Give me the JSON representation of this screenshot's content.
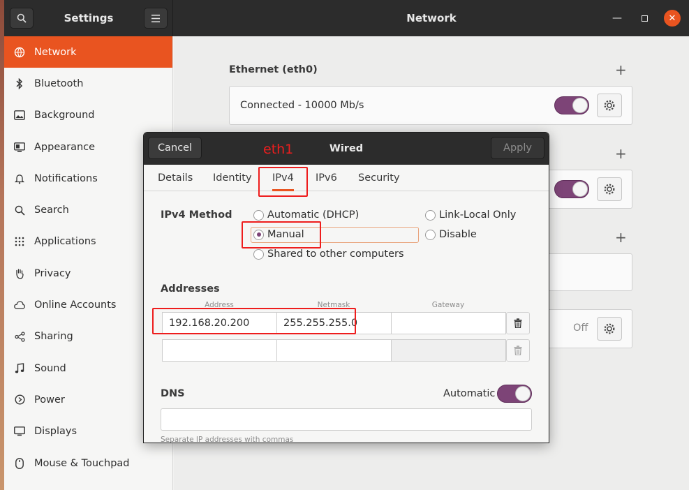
{
  "window": {
    "sidebar_title": "Settings",
    "title": "Network",
    "minimize_icon": "minimize-icon",
    "maximize_icon": "maximize-icon",
    "close_icon": "close-icon"
  },
  "sidebar": {
    "items": [
      {
        "label": "Network",
        "icon": "network-icon",
        "active": true
      },
      {
        "label": "Bluetooth",
        "icon": "bluetooth-icon"
      },
      {
        "label": "Background",
        "icon": "background-icon"
      },
      {
        "label": "Appearance",
        "icon": "appearance-icon"
      },
      {
        "label": "Notifications",
        "icon": "bell-icon"
      },
      {
        "label": "Search",
        "icon": "search-icon"
      },
      {
        "label": "Applications",
        "icon": "grid-icon"
      },
      {
        "label": "Privacy",
        "icon": "hand-icon"
      },
      {
        "label": "Online Accounts",
        "icon": "cloud-icon"
      },
      {
        "label": "Sharing",
        "icon": "share-icon"
      },
      {
        "label": "Sound",
        "icon": "music-note-icon"
      },
      {
        "label": "Power",
        "icon": "power-icon"
      },
      {
        "label": "Displays",
        "icon": "display-icon"
      },
      {
        "label": "Mouse & Touchpad",
        "icon": "mouse-icon"
      }
    ]
  },
  "main": {
    "ethernet_title": "Ethernet (eth0)",
    "ethernet_status": "Connected - 10000 Mb/s",
    "off_label": "Off"
  },
  "dialog": {
    "cancel": "Cancel",
    "title": "Wired",
    "apply": "Apply",
    "tabs": [
      "Details",
      "Identity",
      "IPv4",
      "IPv6",
      "Security"
    ],
    "active_tab": "IPv4",
    "ipv4_method_label": "IPv4 Method",
    "methods": {
      "automatic": "Automatic (DHCP)",
      "link_local": "Link-Local Only",
      "manual": "Manual",
      "disable": "Disable",
      "shared": "Shared to other computers"
    },
    "selected_method": "Manual",
    "addresses_label": "Addresses",
    "columns": {
      "address": "Address",
      "netmask": "Netmask",
      "gateway": "Gateway"
    },
    "rows": [
      {
        "address": "192.168.20.200",
        "netmask": "255.255.255.0",
        "gateway": ""
      },
      {
        "address": "",
        "netmask": "",
        "gateway": ""
      }
    ],
    "dns_label": "DNS",
    "dns_automatic_label": "Automatic",
    "dns_value": "",
    "dns_hint": "Separate IP addresses with commas"
  },
  "annotation": {
    "label": "eth1",
    "color": "#ee1d1d"
  },
  "colors": {
    "accent": "#e95420",
    "toggle_on": "#7d4477",
    "headerbar": "#2c2c2c"
  }
}
